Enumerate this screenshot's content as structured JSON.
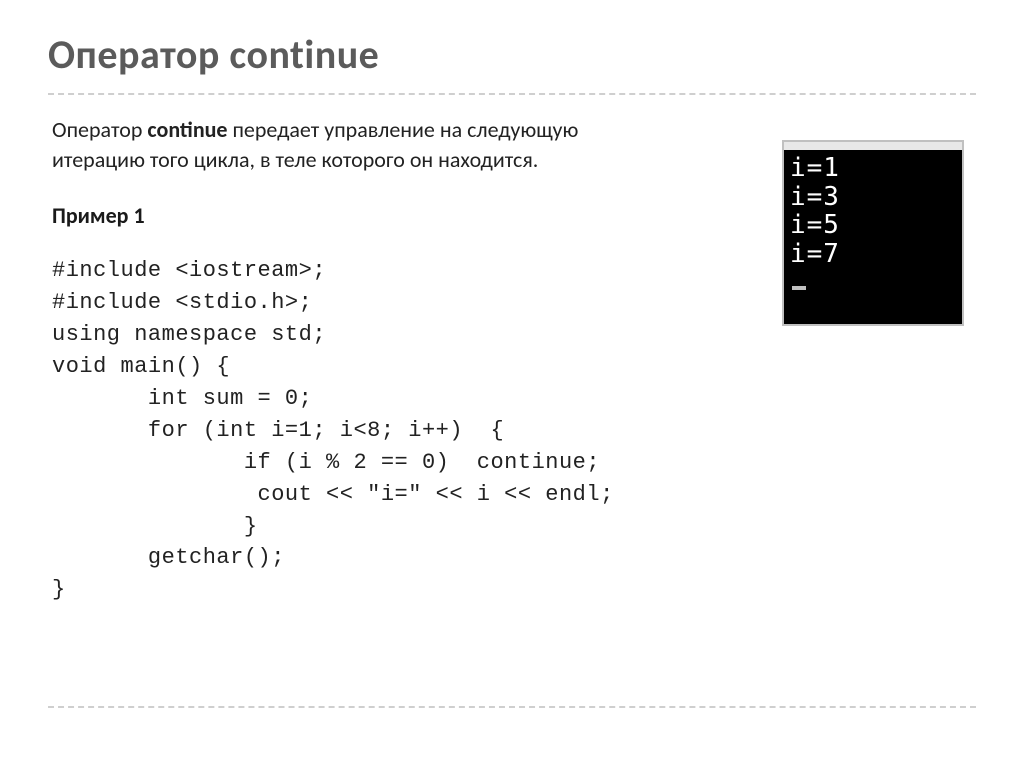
{
  "title": "Оператор continue",
  "paragraph_prefix": "Оператор ",
  "paragraph_bold": "continue",
  "paragraph_suffix": " передает управление на следующую итерацию того цикла, в теле которого он находится.",
  "example_label": "Пример 1",
  "code": {
    "l1": "#include <iostream>;",
    "l2": "#include <stdio.h>;",
    "l3": "using namespace std;",
    "l4": "void main() {",
    "l5": "       int sum = 0;",
    "l6": "       for (int i=1; i<8; i++)  {",
    "l7": "              if (i % 2 == 0)  continue;",
    "l8": "               cout << \"i=\" << i << endl;",
    "l9": "              }",
    "l10": "       getchar();",
    "l11": "}"
  },
  "console": {
    "lines": [
      "i=1",
      "i=3",
      "i=5",
      "i=7"
    ]
  }
}
